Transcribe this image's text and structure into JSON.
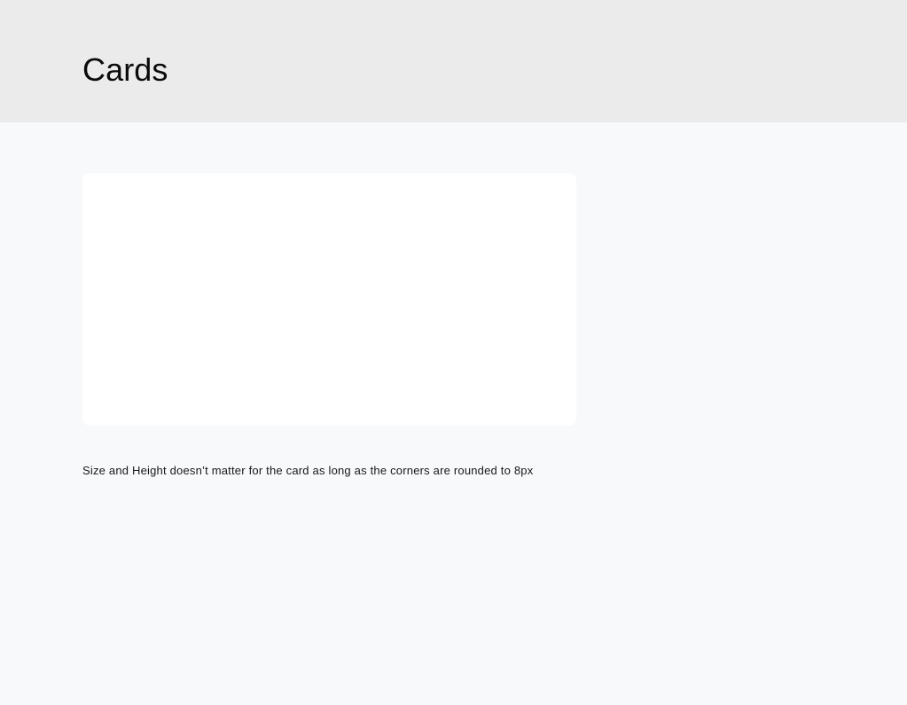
{
  "header": {
    "title": "Cards",
    "background_color": "#ebebec"
  },
  "page": {
    "background_color": "#f7f9fb"
  },
  "main": {
    "card": {
      "background_color": "#ffffff",
      "corner_radius": "8px",
      "content": ""
    },
    "caption": "Size and Height doesn’t matter for the card as long as the corners are rounded to 8px"
  }
}
